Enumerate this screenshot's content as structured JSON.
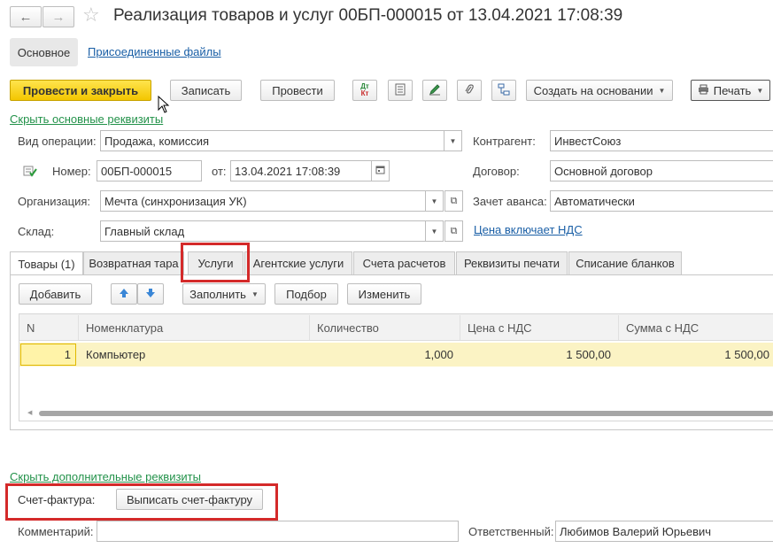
{
  "window": {
    "title": "Реализация товаров и услуг 00БП-000015 от 13.04.2021 17:08:39"
  },
  "nav": {
    "main_label": "Основное",
    "files_label": "Присоединенные файлы"
  },
  "toolbar": {
    "post_close": "Провести и закрыть",
    "save": "Записать",
    "post": "Провести",
    "create_based": "Создать на основании",
    "print": "Печать"
  },
  "links": {
    "hide_main": "Скрыть основные реквизиты",
    "hide_extra": "Скрыть дополнительные реквизиты",
    "vat_included": "Цена включает НДС"
  },
  "form": {
    "operation_label": "Вид операции:",
    "operation_value": "Продажа, комиссия",
    "number_label": "Номер:",
    "number_value": "00БП-000015",
    "date_label": "от:",
    "date_value": "13.04.2021 17:08:39",
    "org_label": "Организация:",
    "org_value": "Мечта (синхронизация УК)",
    "warehouse_label": "Склад:",
    "warehouse_value": "Главный склад",
    "counterparty_label": "Контрагент:",
    "counterparty_value": "ИнвестСоюз",
    "contract_label": "Договор:",
    "contract_value": "Основной договор",
    "advance_label": "Зачет аванса:",
    "advance_value": "Автоматически"
  },
  "tabs": [
    "Товары (1)",
    "Возвратная тара",
    "Услуги",
    "Агентские услуги",
    "Счета расчетов",
    "Реквизиты печати",
    "Списание бланков"
  ],
  "table_toolbar": {
    "add": "Добавить",
    "fill": "Заполнить",
    "select": "Подбор",
    "change": "Изменить"
  },
  "table": {
    "headers": [
      "N",
      "Номенклатура",
      "Количество",
      "Цена с НДС",
      "Сумма с НДС"
    ],
    "rows": [
      [
        "1",
        "Компьютер",
        "1,000",
        "1 500,00",
        "1 500,00"
      ]
    ]
  },
  "invoice": {
    "label": "Счет-фактура:",
    "button": "Выписать счет-фактуру"
  },
  "footer": {
    "comment_label": "Комментарий:",
    "comment_value": "",
    "responsible_label": "Ответственный:",
    "responsible_value": "Любимов Валерий Юрьевич"
  },
  "colors": {
    "primary_button": "#f3c600",
    "highlight_row": "#fbf3c4",
    "highlight_frame": "#d42a2a",
    "link": "#1a5fa6",
    "green_link": "#23924a"
  }
}
